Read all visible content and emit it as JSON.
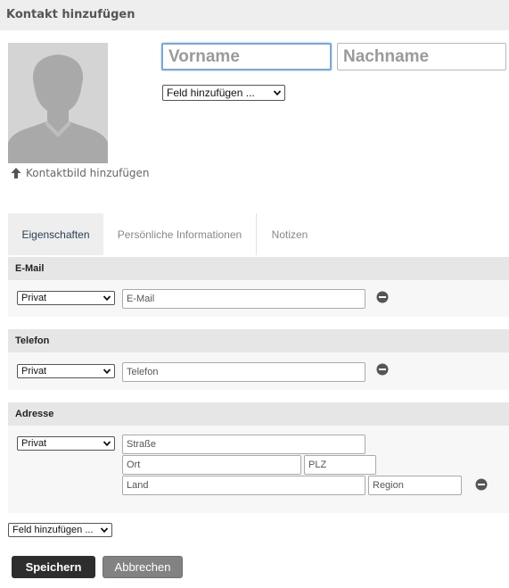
{
  "header": {
    "title": "Kontakt hinzufügen"
  },
  "photo": {
    "add_label": "Kontaktbild hinzufügen",
    "icon": "upload-arrow-icon"
  },
  "name": {
    "first_placeholder": "Vorname",
    "last_placeholder": "Nachname"
  },
  "add_field_top": {
    "selected": "Feld hinzufügen ..."
  },
  "tabs": [
    {
      "label": "Eigenschaften",
      "active": true
    },
    {
      "label": "Persönliche Informationen",
      "active": false
    },
    {
      "label": "Notizen",
      "active": false
    }
  ],
  "email": {
    "title": "E-Mail",
    "type": "Privat",
    "placeholder": "E-Mail"
  },
  "phone": {
    "title": "Telefon",
    "type": "Privat",
    "placeholder": "Telefon"
  },
  "address": {
    "title": "Adresse",
    "type": "Privat",
    "street_placeholder": "Straße",
    "city_placeholder": "Ort",
    "zip_placeholder": "PLZ",
    "country_placeholder": "Land",
    "region_placeholder": "Region"
  },
  "add_field_bottom": {
    "selected": "Feld hinzufügen ..."
  },
  "buttons": {
    "save": "Speichern",
    "cancel": "Abbrechen"
  },
  "colors": {
    "header_bg": "#eeeeee",
    "save_bg": "#2e2e2e",
    "cancel_bg": "#828282",
    "focus_border": "#7fa7cf"
  }
}
